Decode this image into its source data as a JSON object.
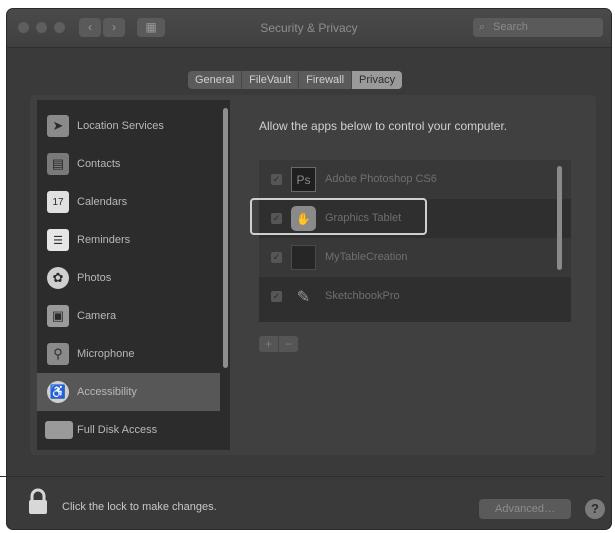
{
  "window": {
    "title": "Security & Privacy",
    "search_placeholder": "Search"
  },
  "toolbar": {
    "back_glyph": "‹",
    "forward_glyph": "›",
    "grid_glyph": "▦"
  },
  "tabs": [
    {
      "label": "General",
      "active": false
    },
    {
      "label": "FileVault",
      "active": false
    },
    {
      "label": "Firewall",
      "active": false
    },
    {
      "label": "Privacy",
      "active": true
    }
  ],
  "sidebar": {
    "items": [
      {
        "label": "Location Services",
        "icon": "location-arrow-icon",
        "color": "#8a8a8a",
        "selected": false
      },
      {
        "label": "Contacts",
        "icon": "contacts-book-icon",
        "color": "#7a7a7a",
        "selected": false
      },
      {
        "label": "Calendars",
        "icon": "calendar-icon",
        "color": "#e0e0e0",
        "selected": false
      },
      {
        "label": "Reminders",
        "icon": "reminders-list-icon",
        "color": "#e6e6e6",
        "selected": false
      },
      {
        "label": "Photos",
        "icon": "photos-flower-icon",
        "color": "#cfcfcf",
        "selected": false
      },
      {
        "label": "Camera",
        "icon": "camera-icon",
        "color": "#9a9a9a",
        "selected": false
      },
      {
        "label": "Microphone",
        "icon": "microphone-icon",
        "color": "#8a8a8a",
        "selected": false
      },
      {
        "label": "Accessibility",
        "icon": "accessibility-person-icon",
        "color": "#d0d0d0",
        "selected": true
      },
      {
        "label": "Full Disk Access",
        "icon": "folder-icon",
        "color": "#9a9a9a",
        "selected": false
      }
    ]
  },
  "main": {
    "instruction": "Allow the apps below to control your computer.",
    "apps": [
      {
        "name": "Adobe Photoshop CS6",
        "icon": "photoshop-icon",
        "icon_text": "Ps",
        "checked": true
      },
      {
        "name": "Graphics Tablet",
        "icon": "graphics-tablet-icon",
        "icon_text": "",
        "checked": true
      },
      {
        "name": "MyTableCreation",
        "icon": "app-generic-icon",
        "icon_text": "",
        "checked": true
      },
      {
        "name": "SketchbookPro",
        "icon": "sketchbook-pen-icon",
        "icon_text": "",
        "checked": true
      }
    ],
    "add_glyph": "+",
    "remove_glyph": "−"
  },
  "footer": {
    "lock_text": "Click the lock to make changes.",
    "advanced_label": "Advanced…",
    "help_glyph": "?"
  }
}
